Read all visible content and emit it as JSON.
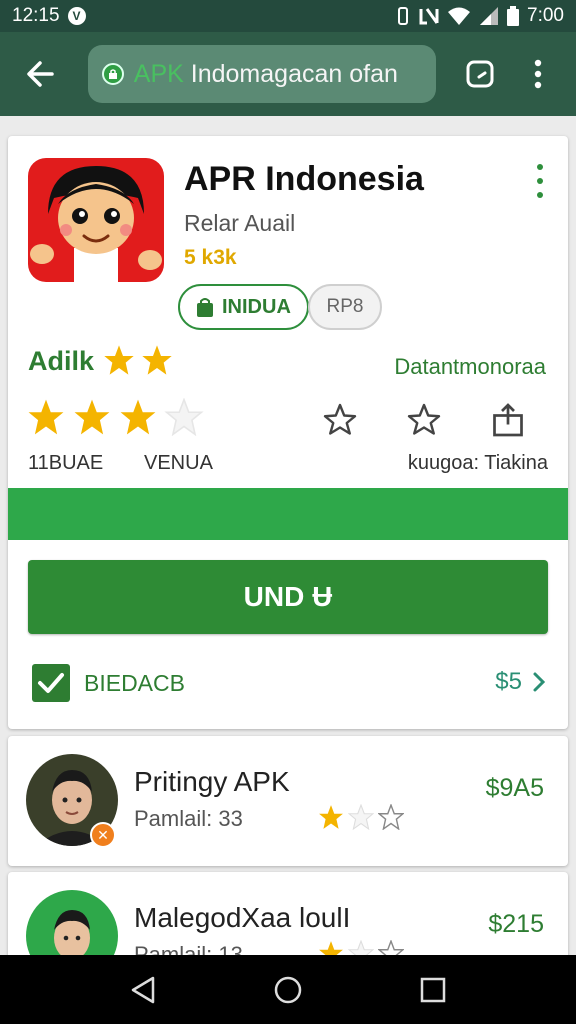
{
  "status_bar": {
    "time": "12:15",
    "badge": "V",
    "clock_right": "7:00",
    "icons": [
      "vibrate-icon",
      "nfc-icon",
      "wifi-icon",
      "signal-icon",
      "battery-icon"
    ]
  },
  "toolbar": {
    "url_accent": "APK",
    "url_rest": " Indomagacan ofan",
    "icons": [
      "back-arrow-icon",
      "lock-icon",
      "tab-switch-icon",
      "more-vert-icon"
    ]
  },
  "app": {
    "title": "APR Indonesia",
    "developer": "Relar Auail",
    "downloads": "5 k3k",
    "chip_green": "INIDUA",
    "chip_gray": "RP8",
    "rating_label": "Adilk",
    "rating_value": 2,
    "right_label": "Datantmonoraa",
    "big_stars_value": 3,
    "stat_left1": "11BUAE",
    "stat_left2": "VENUA",
    "stat_right": "kuugoa: Tiakina",
    "install_label": "UND Ʉ",
    "check_label": "BIEDACB",
    "price_link": "$5"
  },
  "list": [
    {
      "title": "Pritingy APK",
      "subtitle": "Pamlail: 33",
      "price": "$9A5",
      "stars": 1
    },
    {
      "title": "MalegodXaa loulI",
      "subtitle": "Pamlail: 13",
      "price": "$215",
      "stars": 1
    }
  ],
  "colors": {
    "status_bar": "#244a3d",
    "toolbar": "#2e5b47",
    "accent_green": "#2e8b35",
    "strip_green": "#2ea84a",
    "star": "#f4b400"
  }
}
